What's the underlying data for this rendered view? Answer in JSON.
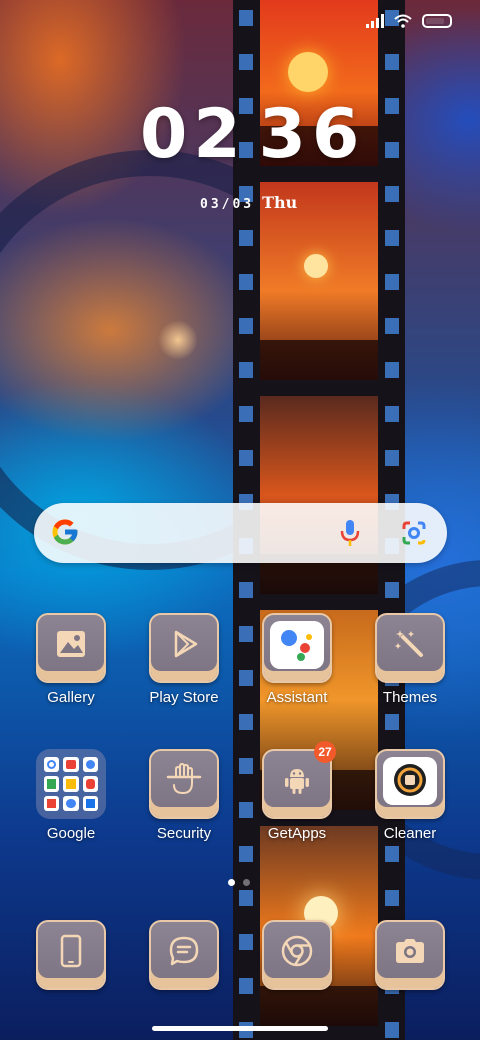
{
  "status_bar": {
    "signal_icon": "cellular-signal-icon",
    "wifi_icon": "wifi-icon",
    "battery_icon": "battery-icon"
  },
  "clock": {
    "hours": "02",
    "minutes": "36",
    "date": "03/03",
    "weekday": "Thu"
  },
  "search_bar": {
    "logo_icon": "google-g-icon",
    "mic_icon": "microphone-icon",
    "lens_icon": "google-lens-icon"
  },
  "apps_row1": [
    {
      "label": "Gallery",
      "icon": "image-icon"
    },
    {
      "label": "Play Store",
      "icon": "play-triangle-icon"
    },
    {
      "label": "Assistant",
      "icon": "google-assistant-icon"
    },
    {
      "label": "Themes",
      "icon": "magic-wand-icon"
    }
  ],
  "apps_row2": [
    {
      "label": "Google",
      "icon": "folder-icon"
    },
    {
      "label": "Security",
      "icon": "shield-hand-icon"
    },
    {
      "label": "GetApps",
      "icon": "android-icon",
      "badge": "27"
    },
    {
      "label": "Cleaner",
      "icon": "cleaner-icon"
    }
  ],
  "dock": [
    {
      "icon": "phone-icon"
    },
    {
      "icon": "message-icon"
    },
    {
      "icon": "chrome-icon"
    },
    {
      "icon": "camera-icon"
    }
  ],
  "page_indicator": {
    "pages": 2,
    "current": 1
  },
  "colors": {
    "tile_top": "#8d8493",
    "tile_trim": "#e7c39c",
    "badge": "#f25a2b"
  }
}
